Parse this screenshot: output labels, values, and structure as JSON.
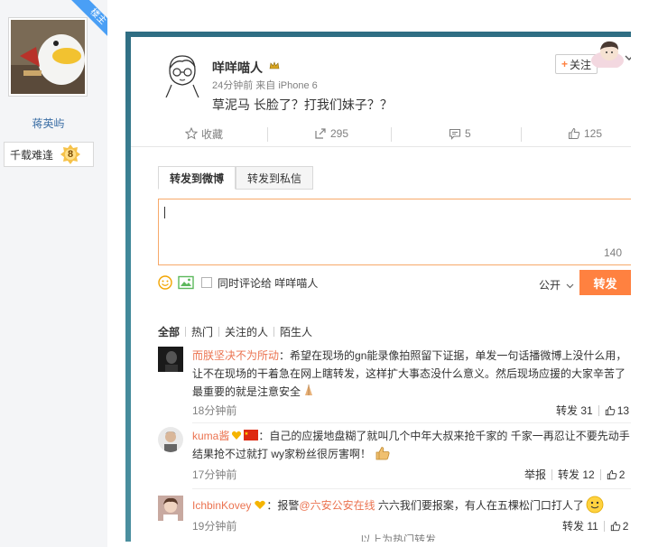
{
  "sidebar": {
    "owner_badge": "楼主",
    "username": "蒋英屿",
    "rank_label": "千载难逢",
    "rank_level": "8"
  },
  "post": {
    "author": "咩咩喵人",
    "meta": "24分钟前 来自 iPhone 6",
    "text": "草泥马 长脸了？打我们妹子？？",
    "follow_label": "关注",
    "follow_plus": "+"
  },
  "actions": {
    "favorite": "收藏",
    "repost": "295",
    "comment": "5",
    "like": "125"
  },
  "compose": {
    "tab_weibo": "转发到微博",
    "tab_private": "转发到私信",
    "char_count": "140",
    "also_comment": "同时评论给 咩咩喵人",
    "visibility": "公开",
    "submit": "转发"
  },
  "filters": [
    "全部",
    "热门",
    "关注的人",
    "陌生人"
  ],
  "comments": [
    {
      "name": "而朕坚决不为所动",
      "text": "：希望在现场的gn能录像拍照留下证据，单发一句话播微博上没什么用，让不在现场的干着急在网上瞎转发，这样扩大事态没什么意义。然后现场应援的大家辛苦了最重要的就是注意安全",
      "time": "18分钟前",
      "repost": "转发 31",
      "like": "13"
    },
    {
      "name": "kuma酱",
      "text": "：自己的应援地盘糊了就叫几个中年大叔来抢千家的  千家一再忍让不要先动手 结果抢不过就打  wy家粉丝很厉害啊！",
      "time": "17分钟前",
      "report": "举报",
      "repost": "转发 12",
      "like": "2"
    },
    {
      "name": "IchbinKovey",
      "text_prefix": "：报警",
      "mention": "@六安公安在线",
      "text_suffix": " 六六我们要报案，有人在五棵松门口打人了",
      "time": "19分钟前",
      "repost": "转发 11",
      "like": "2"
    }
  ],
  "more_link": "以上为热门转发",
  "colors": {
    "accent": "#ff8140",
    "link": "#eb7350",
    "owner_ribbon": "#4a9ff5",
    "name_blue": "#3b6ea5"
  },
  "icons": [
    "star-icon",
    "repost-icon",
    "comment-icon",
    "like-icon",
    "emoji-icon",
    "image-icon",
    "chevron-down-icon",
    "crown-icon"
  ]
}
